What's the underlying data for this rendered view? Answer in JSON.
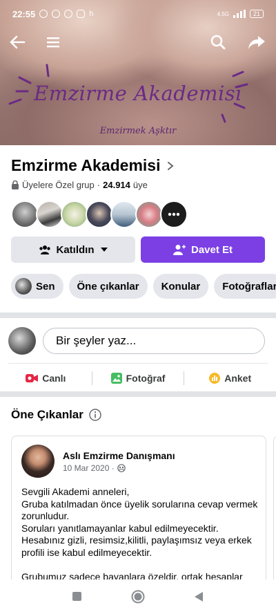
{
  "status_bar": {
    "time": "22:55",
    "extra": "h",
    "network": "4.5G",
    "battery": "21"
  },
  "cover": {
    "title": "Emzirme Akademisi",
    "subtitle": "Emzirmek Aşktır"
  },
  "group": {
    "name": "Emzirme Akademisi",
    "privacy": "Üyelere Özel grup",
    "separator": "·",
    "members_count": "24.914",
    "members_label": "üye"
  },
  "buttons": {
    "joined": "Katıldın",
    "invite": "Davet Et"
  },
  "chips": [
    "Sen",
    "Öne çıkanlar",
    "Konular",
    "Fotoğraflar"
  ],
  "composer": {
    "placeholder": "Bir şeyler yaz...",
    "live": "Canlı",
    "photo": "Fotoğraf",
    "poll": "Anket"
  },
  "highlights": {
    "title": "Öne Çıkanlar",
    "post": {
      "author": "Aslı Emzirme Danışmanı",
      "date": "10 Mar 2020 ·",
      "lines": [
        "Sevgili Akademi anneleri,",
        "Gruba katılmadan önce üyelik sorularına cevap vermek zorunludur.",
        "Soruları yanıtlamayanlar kabul edilmeyecektir.",
        "Hesabınız gizli, resimsiz,kilitli, paylaşımsız veya erkek profili ise kabul edilmeyecektir.",
        "",
        "Grubumuz sadece bayanlara özeldir, ortak hesaplar"
      ]
    }
  },
  "colors": {
    "accent": "#7b3fe4",
    "cover_text": "#6b2a86"
  }
}
